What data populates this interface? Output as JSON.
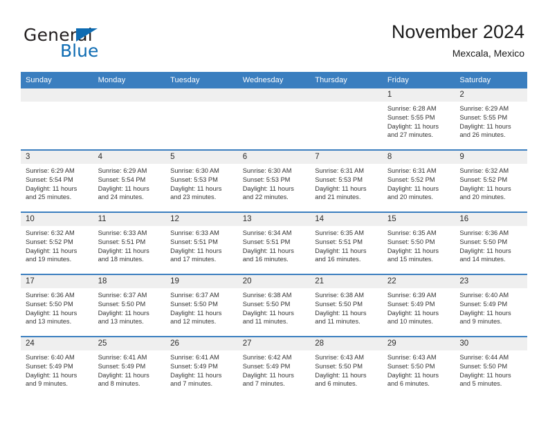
{
  "brand": {
    "name_part1": "General",
    "name_part2": "Blue",
    "triangle_icon": "triangle-icon",
    "accent_color": "#0d6bb2"
  },
  "header": {
    "title": "November 2024",
    "subtitle": "Mexcala, Mexico"
  },
  "theme": {
    "header_blue": "#3a7ebf",
    "daynum_band": "#efefef",
    "text": "#333333"
  },
  "calendar": {
    "weekday_headers": [
      "Sunday",
      "Monday",
      "Tuesday",
      "Wednesday",
      "Thursday",
      "Friday",
      "Saturday"
    ],
    "labels": {
      "sunrise": "Sunrise:",
      "sunset": "Sunset:",
      "daylight": "Daylight:"
    },
    "weeks": [
      [
        {
          "day": "",
          "empty": true
        },
        {
          "day": "",
          "empty": true
        },
        {
          "day": "",
          "empty": true
        },
        {
          "day": "",
          "empty": true
        },
        {
          "day": "",
          "empty": true
        },
        {
          "day": "1",
          "sunrise": "Sunrise: 6:28 AM",
          "sunset": "Sunset: 5:55 PM",
          "daylight1": "Daylight: 11 hours",
          "daylight2": "and 27 minutes."
        },
        {
          "day": "2",
          "sunrise": "Sunrise: 6:29 AM",
          "sunset": "Sunset: 5:55 PM",
          "daylight1": "Daylight: 11 hours",
          "daylight2": "and 26 minutes."
        }
      ],
      [
        {
          "day": "3",
          "sunrise": "Sunrise: 6:29 AM",
          "sunset": "Sunset: 5:54 PM",
          "daylight1": "Daylight: 11 hours",
          "daylight2": "and 25 minutes."
        },
        {
          "day": "4",
          "sunrise": "Sunrise: 6:29 AM",
          "sunset": "Sunset: 5:54 PM",
          "daylight1": "Daylight: 11 hours",
          "daylight2": "and 24 minutes."
        },
        {
          "day": "5",
          "sunrise": "Sunrise: 6:30 AM",
          "sunset": "Sunset: 5:53 PM",
          "daylight1": "Daylight: 11 hours",
          "daylight2": "and 23 minutes."
        },
        {
          "day": "6",
          "sunrise": "Sunrise: 6:30 AM",
          "sunset": "Sunset: 5:53 PM",
          "daylight1": "Daylight: 11 hours",
          "daylight2": "and 22 minutes."
        },
        {
          "day": "7",
          "sunrise": "Sunrise: 6:31 AM",
          "sunset": "Sunset: 5:53 PM",
          "daylight1": "Daylight: 11 hours",
          "daylight2": "and 21 minutes."
        },
        {
          "day": "8",
          "sunrise": "Sunrise: 6:31 AM",
          "sunset": "Sunset: 5:52 PM",
          "daylight1": "Daylight: 11 hours",
          "daylight2": "and 20 minutes."
        },
        {
          "day": "9",
          "sunrise": "Sunrise: 6:32 AM",
          "sunset": "Sunset: 5:52 PM",
          "daylight1": "Daylight: 11 hours",
          "daylight2": "and 20 minutes."
        }
      ],
      [
        {
          "day": "10",
          "sunrise": "Sunrise: 6:32 AM",
          "sunset": "Sunset: 5:52 PM",
          "daylight1": "Daylight: 11 hours",
          "daylight2": "and 19 minutes."
        },
        {
          "day": "11",
          "sunrise": "Sunrise: 6:33 AM",
          "sunset": "Sunset: 5:51 PM",
          "daylight1": "Daylight: 11 hours",
          "daylight2": "and 18 minutes."
        },
        {
          "day": "12",
          "sunrise": "Sunrise: 6:33 AM",
          "sunset": "Sunset: 5:51 PM",
          "daylight1": "Daylight: 11 hours",
          "daylight2": "and 17 minutes."
        },
        {
          "day": "13",
          "sunrise": "Sunrise: 6:34 AM",
          "sunset": "Sunset: 5:51 PM",
          "daylight1": "Daylight: 11 hours",
          "daylight2": "and 16 minutes."
        },
        {
          "day": "14",
          "sunrise": "Sunrise: 6:35 AM",
          "sunset": "Sunset: 5:51 PM",
          "daylight1": "Daylight: 11 hours",
          "daylight2": "and 16 minutes."
        },
        {
          "day": "15",
          "sunrise": "Sunrise: 6:35 AM",
          "sunset": "Sunset: 5:50 PM",
          "daylight1": "Daylight: 11 hours",
          "daylight2": "and 15 minutes."
        },
        {
          "day": "16",
          "sunrise": "Sunrise: 6:36 AM",
          "sunset": "Sunset: 5:50 PM",
          "daylight1": "Daylight: 11 hours",
          "daylight2": "and 14 minutes."
        }
      ],
      [
        {
          "day": "17",
          "sunrise": "Sunrise: 6:36 AM",
          "sunset": "Sunset: 5:50 PM",
          "daylight1": "Daylight: 11 hours",
          "daylight2": "and 13 minutes."
        },
        {
          "day": "18",
          "sunrise": "Sunrise: 6:37 AM",
          "sunset": "Sunset: 5:50 PM",
          "daylight1": "Daylight: 11 hours",
          "daylight2": "and 13 minutes."
        },
        {
          "day": "19",
          "sunrise": "Sunrise: 6:37 AM",
          "sunset": "Sunset: 5:50 PM",
          "daylight1": "Daylight: 11 hours",
          "daylight2": "and 12 minutes."
        },
        {
          "day": "20",
          "sunrise": "Sunrise: 6:38 AM",
          "sunset": "Sunset: 5:50 PM",
          "daylight1": "Daylight: 11 hours",
          "daylight2": "and 11 minutes."
        },
        {
          "day": "21",
          "sunrise": "Sunrise: 6:38 AM",
          "sunset": "Sunset: 5:50 PM",
          "daylight1": "Daylight: 11 hours",
          "daylight2": "and 11 minutes."
        },
        {
          "day": "22",
          "sunrise": "Sunrise: 6:39 AM",
          "sunset": "Sunset: 5:49 PM",
          "daylight1": "Daylight: 11 hours",
          "daylight2": "and 10 minutes."
        },
        {
          "day": "23",
          "sunrise": "Sunrise: 6:40 AM",
          "sunset": "Sunset: 5:49 PM",
          "daylight1": "Daylight: 11 hours",
          "daylight2": "and 9 minutes."
        }
      ],
      [
        {
          "day": "24",
          "sunrise": "Sunrise: 6:40 AM",
          "sunset": "Sunset: 5:49 PM",
          "daylight1": "Daylight: 11 hours",
          "daylight2": "and 9 minutes."
        },
        {
          "day": "25",
          "sunrise": "Sunrise: 6:41 AM",
          "sunset": "Sunset: 5:49 PM",
          "daylight1": "Daylight: 11 hours",
          "daylight2": "and 8 minutes."
        },
        {
          "day": "26",
          "sunrise": "Sunrise: 6:41 AM",
          "sunset": "Sunset: 5:49 PM",
          "daylight1": "Daylight: 11 hours",
          "daylight2": "and 7 minutes."
        },
        {
          "day": "27",
          "sunrise": "Sunrise: 6:42 AM",
          "sunset": "Sunset: 5:49 PM",
          "daylight1": "Daylight: 11 hours",
          "daylight2": "and 7 minutes."
        },
        {
          "day": "28",
          "sunrise": "Sunrise: 6:43 AM",
          "sunset": "Sunset: 5:50 PM",
          "daylight1": "Daylight: 11 hours",
          "daylight2": "and 6 minutes."
        },
        {
          "day": "29",
          "sunrise": "Sunrise: 6:43 AM",
          "sunset": "Sunset: 5:50 PM",
          "daylight1": "Daylight: 11 hours",
          "daylight2": "and 6 minutes."
        },
        {
          "day": "30",
          "sunrise": "Sunrise: 6:44 AM",
          "sunset": "Sunset: 5:50 PM",
          "daylight1": "Daylight: 11 hours",
          "daylight2": "and 5 minutes."
        }
      ]
    ]
  }
}
